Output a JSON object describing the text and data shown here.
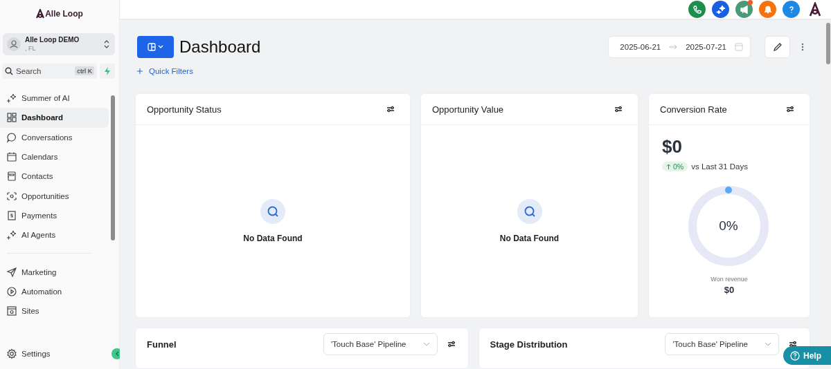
{
  "brand": {
    "name": "Alle Loop"
  },
  "account": {
    "name": "Alle Loop DEMO",
    "location": ", FL"
  },
  "search": {
    "placeholder": "Search",
    "shortcut": "ctrl K"
  },
  "nav": [
    {
      "label": "Summer of AI",
      "kind": "sparkle",
      "selected": false
    },
    {
      "label": "Dashboard",
      "kind": "grid",
      "selected": true
    },
    {
      "label": "Conversations",
      "kind": "chat",
      "selected": false
    },
    {
      "label": "Calendars",
      "kind": "calendar",
      "selected": false
    },
    {
      "label": "Contacts",
      "kind": "contact",
      "selected": false
    },
    {
      "label": "Opportunities",
      "kind": "funnel",
      "selected": false
    },
    {
      "label": "Payments",
      "kind": "payment",
      "selected": false
    },
    {
      "label": "AI Agents",
      "kind": "sparkle",
      "selected": false
    }
  ],
  "nav2": [
    {
      "label": "Marketing",
      "kind": "send",
      "selected": false
    },
    {
      "label": "Automation",
      "kind": "play",
      "selected": false
    },
    {
      "label": "Sites",
      "kind": "site",
      "selected": false
    }
  ],
  "settings": {
    "label": "Settings"
  },
  "topbar": [
    {
      "kind": "phone",
      "color": "#1e8e4e",
      "badge": false
    },
    {
      "kind": "sparkle",
      "color": "#1a5fe0",
      "badge": false
    },
    {
      "kind": "megaphone",
      "color": "#4a9a78",
      "badge": true
    },
    {
      "kind": "bell",
      "color": "#f5720f",
      "badge": false
    },
    {
      "kind": "help",
      "color": "#1e88e5",
      "badge": false
    }
  ],
  "page": {
    "title": "Dashboard",
    "quick_filters": "Quick Filters",
    "date_from": "2025-06-21",
    "date_to": "2025-07-21"
  },
  "cards": [
    {
      "title": "Opportunity Status",
      "kind": "empty",
      "message": "No Data Found"
    },
    {
      "title": "Opportunity Value",
      "kind": "empty",
      "message": "No Data Found"
    },
    {
      "title": "Conversion Rate",
      "kind": "gauge",
      "amount": "$0",
      "change": "0%",
      "compare": "vs Last 31 Days",
      "gauge_label": "0%",
      "revenue_label": "Won revenue",
      "revenue": "$0"
    }
  ],
  "bottom_cards": [
    {
      "title": "Funnel",
      "pipeline": "'Touch Base' Pipeline"
    },
    {
      "title": "Stage Distribution",
      "pipeline": "'Touch Base' Pipeline"
    }
  ],
  "help_button": {
    "label": "Help"
  }
}
